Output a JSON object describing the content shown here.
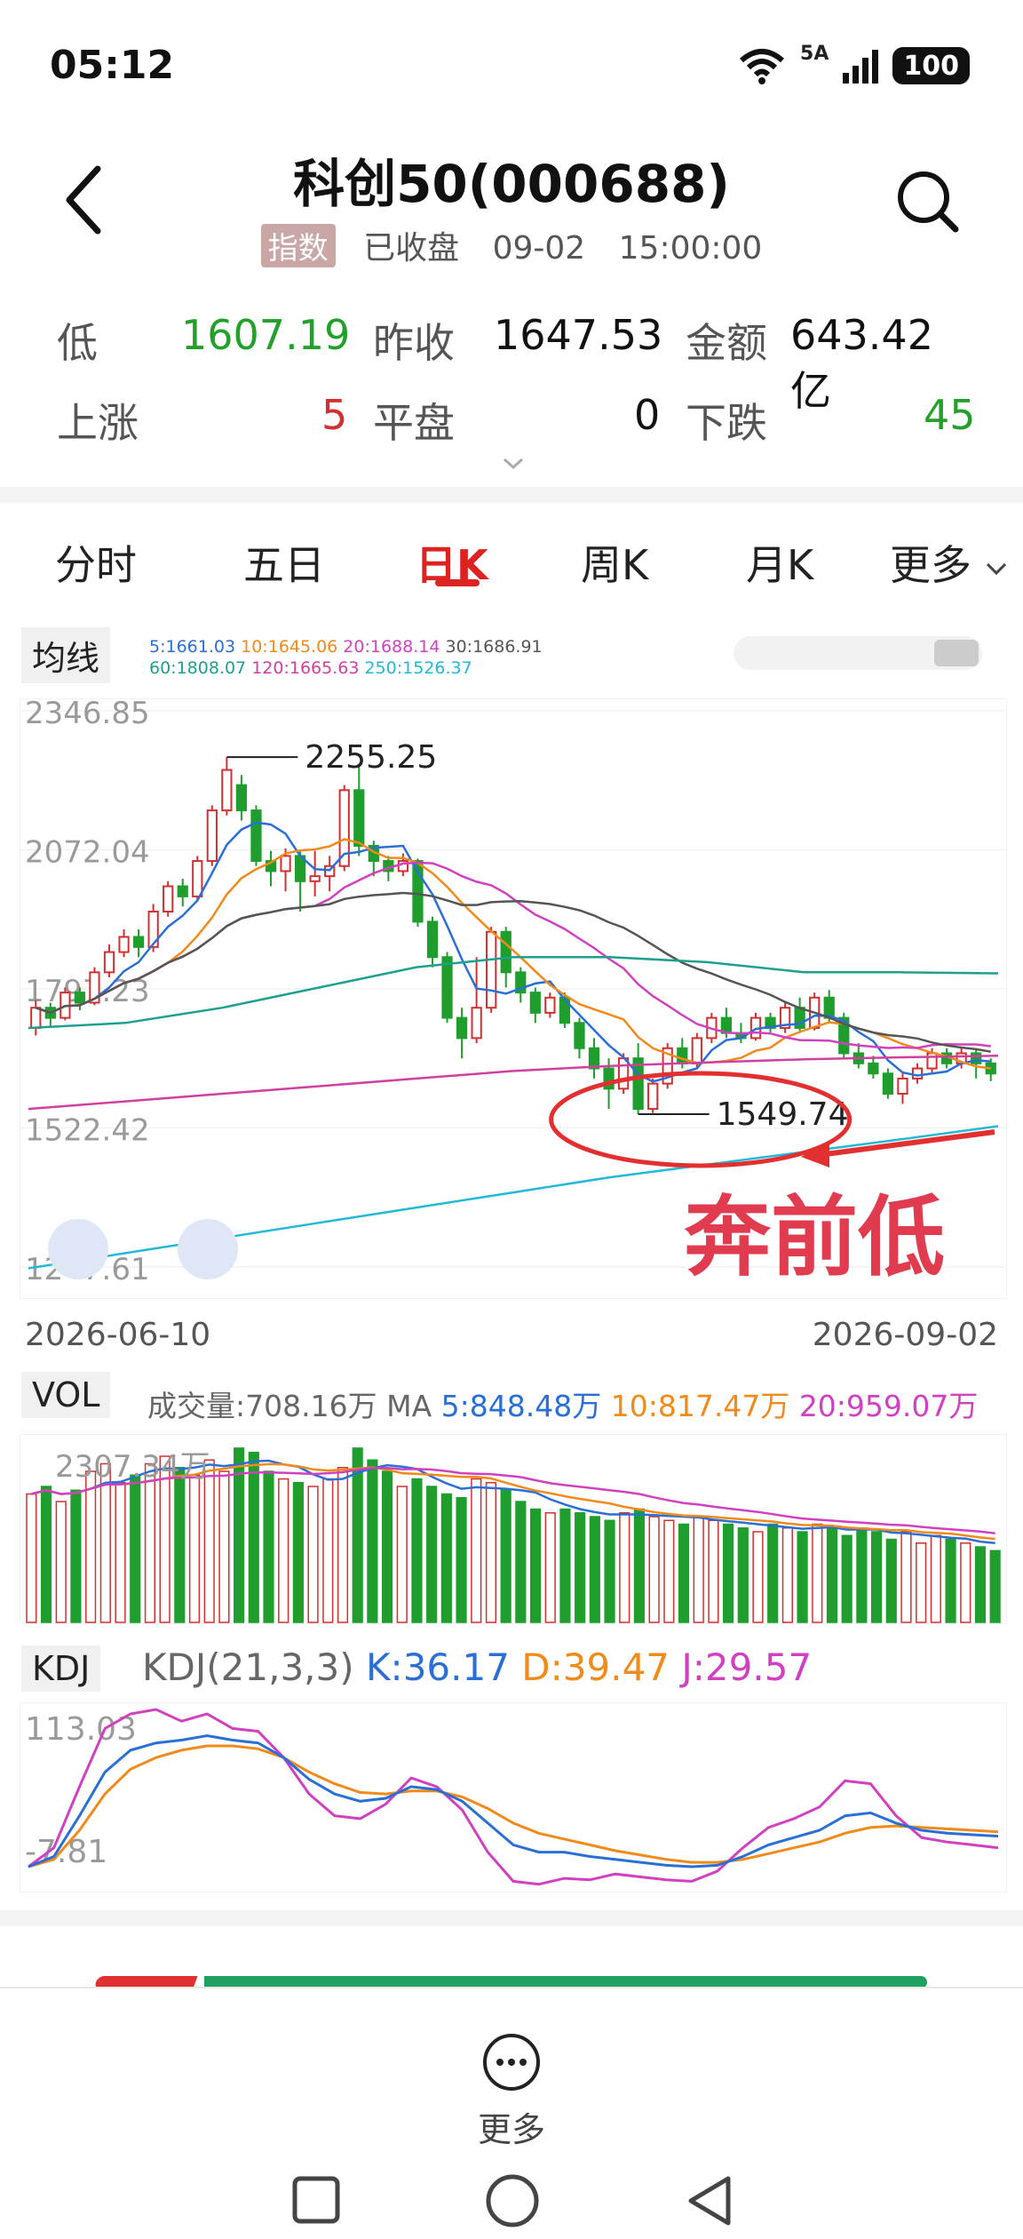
{
  "status": {
    "time": "05:12",
    "network": "5A",
    "battery": "100"
  },
  "header": {
    "title": "科创50(000688)",
    "tag": "指数",
    "status": "已收盘",
    "date": "09-02",
    "time": "15:00:00"
  },
  "stats": {
    "low_label": "低",
    "low_value": "1607.19",
    "prev_close_label": "昨收",
    "prev_close_value": "1647.53",
    "amount_label": "金额",
    "amount_value": "643.42亿",
    "up_label": "上涨",
    "up_value": "5",
    "flat_label": "平盘",
    "flat_value": "0",
    "down_label": "下跌",
    "down_value": "45"
  },
  "tabs": [
    "分时",
    "五日",
    "日K",
    "周K",
    "月K",
    "更多"
  ],
  "active_tab": "日K",
  "kline": {
    "panel_label": "均线",
    "ma_legend": [
      {
        "text": "5:1661.03",
        "color": "#2a6fd6"
      },
      {
        "text": "10:1645.06",
        "color": "#f08a1a"
      },
      {
        "text": "20:1688.14",
        "color": "#d040c0"
      },
      {
        "text": "30:1686.91",
        "color": "#555555"
      },
      {
        "text": "60:1808.07",
        "color": "#1f9f8f"
      },
      {
        "text": "120:1665.63",
        "color": "#d040a0"
      },
      {
        "text": "250:1526.37",
        "color": "#22b8d8"
      }
    ],
    "y_ticks": [
      "2346.85",
      "2072.04",
      "1797.23",
      "1522.42",
      "1247.61"
    ],
    "annotation_high": "2255.25",
    "annotation_low": "1549.74",
    "overlay_text": "奔前低",
    "date_start": "2026-06-10",
    "date_end": "2026-09-02"
  },
  "vol": {
    "panel_label": "VOL",
    "volume_label": "成交量:708.16万",
    "ma_prefix": "MA",
    "ma5": "5:848.48万",
    "ma10": "10:817.47万",
    "ma20": "20:959.07万",
    "max_label": "2307.34万",
    "colors": {
      "ma5": "#2a6fd6",
      "ma10": "#f08a1a",
      "ma20": "#d040c0"
    }
  },
  "kdj": {
    "panel_label": "KDJ",
    "params": "KDJ(21,3,3)",
    "k": "K:36.17",
    "d": "D:39.47",
    "j": "J:29.57",
    "top_label": "113.03",
    "bottom_label": "-7.81",
    "colors": {
      "k": "#2a6fd6",
      "d": "#f08a1a",
      "j": "#d040c0"
    }
  },
  "bottom": {
    "more_label": "更多"
  },
  "chart_data": {
    "type": "candlestick",
    "title": "",
    "x_range": [
      "2026-06-10",
      "2026-09-02"
    ],
    "y_range": [
      1247.61,
      2346.85
    ],
    "annotations": [
      {
        "label": "2255.25",
        "value": 2255.25
      },
      {
        "label": "1549.74",
        "value": 1549.74
      },
      {
        "label": "奔前低"
      }
    ],
    "candles": [
      {
        "o": 1720,
        "c": 1760,
        "h": 1775,
        "l": 1705
      },
      {
        "o": 1760,
        "c": 1740,
        "h": 1770,
        "l": 1720
      },
      {
        "o": 1740,
        "c": 1790,
        "h": 1800,
        "l": 1735
      },
      {
        "o": 1790,
        "c": 1770,
        "h": 1800,
        "l": 1755
      },
      {
        "o": 1770,
        "c": 1830,
        "h": 1840,
        "l": 1765
      },
      {
        "o": 1830,
        "c": 1870,
        "h": 1885,
        "l": 1820
      },
      {
        "o": 1870,
        "c": 1900,
        "h": 1915,
        "l": 1860
      },
      {
        "o": 1900,
        "c": 1880,
        "h": 1915,
        "l": 1860
      },
      {
        "o": 1880,
        "c": 1950,
        "h": 1965,
        "l": 1870
      },
      {
        "o": 1950,
        "c": 2000,
        "h": 2010,
        "l": 1940
      },
      {
        "o": 2000,
        "c": 1980,
        "h": 2015,
        "l": 1960
      },
      {
        "o": 1980,
        "c": 2050,
        "h": 2060,
        "l": 1970
      },
      {
        "o": 2050,
        "c": 2150,
        "h": 2160,
        "l": 2040
      },
      {
        "o": 2150,
        "c": 2230,
        "h": 2255,
        "l": 2140
      },
      {
        "o": 2200,
        "c": 2150,
        "h": 2220,
        "l": 2130
      },
      {
        "o": 2150,
        "c": 2050,
        "h": 2160,
        "l": 2040
      },
      {
        "o": 2050,
        "c": 2030,
        "h": 2070,
        "l": 2000
      },
      {
        "o": 2030,
        "c": 2060,
        "h": 2075,
        "l": 1990
      },
      {
        "o": 2060,
        "c": 2010,
        "h": 2070,
        "l": 1950
      },
      {
        "o": 2010,
        "c": 2020,
        "h": 2070,
        "l": 1980
      },
      {
        "o": 2020,
        "c": 2040,
        "h": 2060,
        "l": 1990
      },
      {
        "o": 2040,
        "c": 2190,
        "h": 2200,
        "l": 2030
      },
      {
        "o": 2190,
        "c": 2080,
        "h": 2240,
        "l": 2060
      },
      {
        "o": 2080,
        "c": 2050,
        "h": 2090,
        "l": 2020
      },
      {
        "o": 2050,
        "c": 2030,
        "h": 2060,
        "l": 2010
      },
      {
        "o": 2030,
        "c": 2050,
        "h": 2065,
        "l": 2020
      },
      {
        "o": 2050,
        "c": 1930,
        "h": 2055,
        "l": 1920
      },
      {
        "o": 1930,
        "c": 1860,
        "h": 1940,
        "l": 1840
      },
      {
        "o": 1860,
        "c": 1740,
        "h": 1870,
        "l": 1730
      },
      {
        "o": 1740,
        "c": 1700,
        "h": 1760,
        "l": 1660
      },
      {
        "o": 1700,
        "c": 1760,
        "h": 1860,
        "l": 1690
      },
      {
        "o": 1760,
        "c": 1910,
        "h": 1920,
        "l": 1750
      },
      {
        "o": 1910,
        "c": 1830,
        "h": 1920,
        "l": 1800
      },
      {
        "o": 1830,
        "c": 1790,
        "h": 1840,
        "l": 1770
      },
      {
        "o": 1790,
        "c": 1750,
        "h": 1800,
        "l": 1730
      },
      {
        "o": 1750,
        "c": 1780,
        "h": 1790,
        "l": 1740
      },
      {
        "o": 1780,
        "c": 1730,
        "h": 1790,
        "l": 1720
      },
      {
        "o": 1730,
        "c": 1680,
        "h": 1740,
        "l": 1660
      },
      {
        "o": 1680,
        "c": 1640,
        "h": 1700,
        "l": 1620
      },
      {
        "o": 1640,
        "c": 1600,
        "h": 1660,
        "l": 1560
      },
      {
        "o": 1600,
        "c": 1660,
        "h": 1670,
        "l": 1590
      },
      {
        "o": 1660,
        "c": 1560,
        "h": 1690,
        "l": 1549.74
      },
      {
        "o": 1560,
        "c": 1610,
        "h": 1620,
        "l": 1552
      },
      {
        "o": 1610,
        "c": 1680,
        "h": 1690,
        "l": 1600
      },
      {
        "o": 1680,
        "c": 1650,
        "h": 1700,
        "l": 1640
      },
      {
        "o": 1650,
        "c": 1700,
        "h": 1710,
        "l": 1640
      },
      {
        "o": 1700,
        "c": 1740,
        "h": 1750,
        "l": 1690
      },
      {
        "o": 1740,
        "c": 1710,
        "h": 1760,
        "l": 1700
      },
      {
        "o": 1710,
        "c": 1700,
        "h": 1730,
        "l": 1690
      },
      {
        "o": 1700,
        "c": 1740,
        "h": 1750,
        "l": 1695
      },
      {
        "o": 1740,
        "c": 1720,
        "h": 1750,
        "l": 1710
      },
      {
        "o": 1720,
        "c": 1760,
        "h": 1770,
        "l": 1710
      },
      {
        "o": 1760,
        "c": 1720,
        "h": 1780,
        "l": 1710
      },
      {
        "o": 1720,
        "c": 1780,
        "h": 1790,
        "l": 1715
      },
      {
        "o": 1780,
        "c": 1740,
        "h": 1795,
        "l": 1730
      },
      {
        "o": 1740,
        "c": 1670,
        "h": 1750,
        "l": 1660
      },
      {
        "o": 1670,
        "c": 1650,
        "h": 1690,
        "l": 1640
      },
      {
        "o": 1650,
        "c": 1630,
        "h": 1665,
        "l": 1620
      },
      {
        "o": 1630,
        "c": 1590,
        "h": 1640,
        "l": 1580
      },
      {
        "o": 1590,
        "c": 1620,
        "h": 1630,
        "l": 1570
      },
      {
        "o": 1620,
        "c": 1640,
        "h": 1650,
        "l": 1610
      },
      {
        "o": 1640,
        "c": 1670,
        "h": 1680,
        "l": 1630
      },
      {
        "o": 1670,
        "c": 1650,
        "h": 1680,
        "l": 1640
      },
      {
        "o": 1650,
        "c": 1670,
        "h": 1680,
        "l": 1640
      },
      {
        "o": 1670,
        "c": 1650,
        "h": 1680,
        "l": 1620
      },
      {
        "o": 1650,
        "c": 1630,
        "h": 1660,
        "l": 1615
      }
    ],
    "volume_max": 2307.34,
    "volumes": [
      1700,
      1800,
      1600,
      1750,
      2000,
      2100,
      1850,
      1950,
      2100,
      2200,
      2050,
      1950,
      2150,
      2000,
      2307,
      2250,
      2000,
      1900,
      1850,
      1800,
      1900,
      2050,
      2307,
      2150,
      2000,
      1800,
      1900,
      1800,
      1700,
      1650,
      1900,
      1850,
      1750,
      1600,
      1500,
      1450,
      1500,
      1450,
      1400,
      1350,
      1450,
      1500,
      1400,
      1350,
      1300,
      1400,
      1350,
      1300,
      1250,
      1200,
      1300,
      1250,
      1200,
      1300,
      1250,
      1150,
      1250,
      1200,
      1100,
      1200,
      1050,
      1150,
      1100,
      1050,
      1000,
      950
    ],
    "kdj_range": [
      -7.81,
      113.03
    ],
    "k": [
      5,
      12,
      40,
      70,
      85,
      90,
      92,
      95,
      92,
      90,
      80,
      65,
      55,
      50,
      52,
      60,
      58,
      50,
      35,
      20,
      15,
      15,
      12,
      10,
      8,
      6,
      5,
      6,
      12,
      20,
      25,
      30,
      40,
      42,
      35,
      30,
      28,
      27,
      26
    ],
    "d": [
      5,
      10,
      30,
      55,
      72,
      80,
      85,
      88,
      88,
      86,
      80,
      70,
      62,
      56,
      55,
      57,
      57,
      53,
      45,
      35,
      28,
      24,
      20,
      16,
      13,
      10,
      8,
      8,
      10,
      14,
      18,
      22,
      28,
      32,
      33,
      32,
      31,
      30,
      29
    ],
    "j": [
      5,
      18,
      60,
      100,
      110,
      113,
      105,
      110,
      100,
      98,
      80,
      55,
      40,
      38,
      48,
      66,
      60,
      44,
      15,
      -5,
      -7,
      -3,
      -4,
      0,
      -2,
      -4,
      -5,
      2,
      18,
      32,
      38,
      46,
      64,
      62,
      40,
      25,
      22,
      20,
      18
    ]
  }
}
